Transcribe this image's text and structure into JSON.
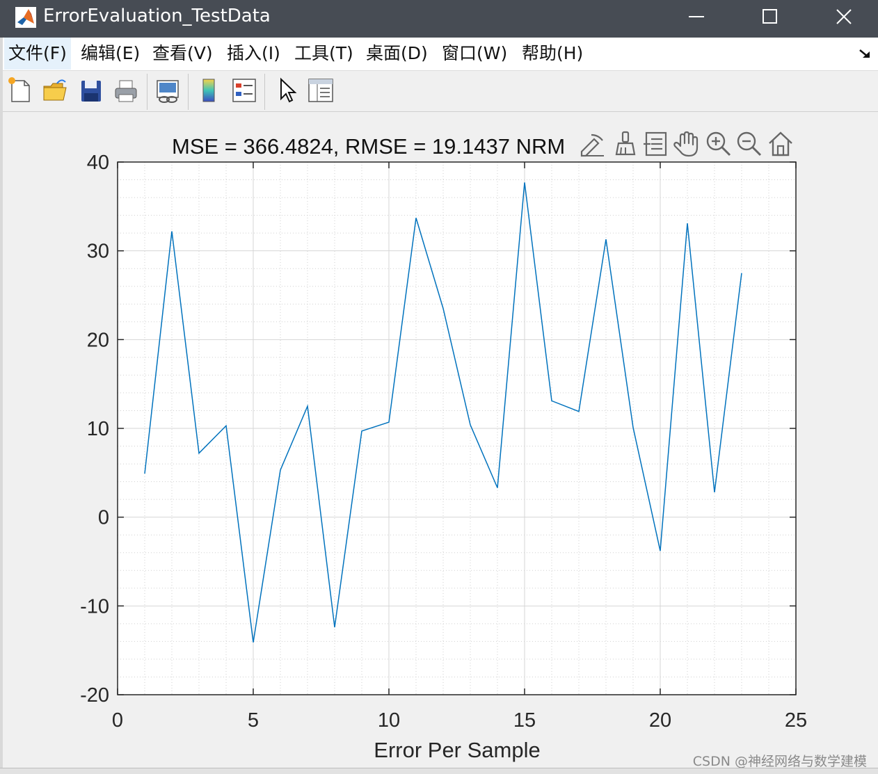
{
  "window": {
    "title": "ErrorEvaluation_TestData"
  },
  "menu": [
    {
      "label": "文件(F)"
    },
    {
      "label": "编辑(E)"
    },
    {
      "label": "查看(V)"
    },
    {
      "label": "插入(I)"
    },
    {
      "label": "工具(T)"
    },
    {
      "label": "桌面(D)"
    },
    {
      "label": "窗口(W)"
    },
    {
      "label": "帮助(H)"
    }
  ],
  "toolbar_icons": [
    "new-figure-icon",
    "open-file-icon",
    "save-icon",
    "print-icon",
    "link-plot-icon",
    "insert-colorbar-icon",
    "insert-legend-icon",
    "edit-plot-icon",
    "property-inspector-icon"
  ],
  "axes_toolbar_icons": [
    "brush-export-icon",
    "data-brush-icon",
    "data-tips-icon",
    "pan-icon",
    "zoom-in-icon",
    "zoom-out-icon",
    "restore-view-icon"
  ],
  "chart_data": {
    "type": "line",
    "title": "MSE = 366.4824, RMSE = 19.1437 NRM",
    "xlabel": "Error Per Sample",
    "ylabel": "",
    "xlim": [
      0,
      25
    ],
    "ylim": [
      -20,
      40
    ],
    "xticks": [
      0,
      5,
      10,
      15,
      20,
      25
    ],
    "yticks": [
      -20,
      -10,
      0,
      10,
      20,
      30,
      40
    ],
    "grid": "on",
    "minor_grid": "on",
    "series": [
      {
        "color": "#0072bd",
        "x": [
          1,
          2,
          3,
          4,
          5,
          6,
          7,
          8,
          9,
          10,
          11,
          12,
          13,
          14,
          15,
          16,
          17,
          18,
          19,
          20,
          21,
          22,
          23
        ],
        "y": [
          4.9,
          32.2,
          7.2,
          10.3,
          -14.1,
          5.3,
          12.5,
          -12.4,
          9.7,
          10.7,
          33.7,
          23.5,
          10.4,
          3.3,
          37.7,
          13.1,
          11.9,
          31.3,
          10.1,
          -3.8,
          33.1,
          2.8,
          27.5
        ]
      }
    ]
  },
  "watermark": "CSDN @神经网络与数学建模"
}
